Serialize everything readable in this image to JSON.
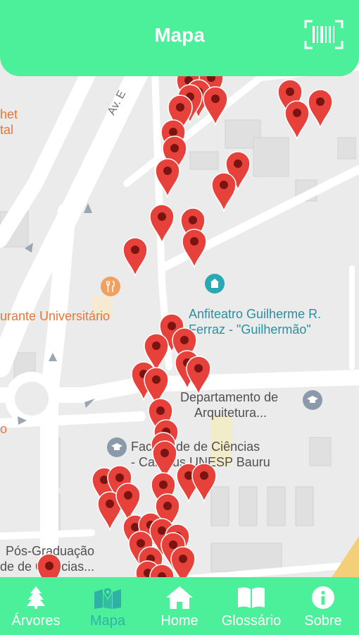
{
  "header": {
    "title": "Mapa",
    "scan_icon": "barcode-scan-icon"
  },
  "map": {
    "labels": {
      "road_av": "Av. E",
      "restaurant": "urante Universitário",
      "anfiteatro_line1": "Anfiteatro Guilherme R.",
      "anfiteatro_line2": "Ferraz - \"Guilhermão\"",
      "departamento_line1": "Departamento de",
      "departamento_line2": "Arquitetura...",
      "faculdade_line1": "Faculdade de Ciências",
      "faculdade_line2": "- Campus UNESP Bauru",
      "posgrad_line1": "Pós-Graduação",
      "posgrad_line2": "de de Ciências...",
      "edge_top1": "het",
      "edge_top2": "tal",
      "edge_mid": "o"
    },
    "colors": {
      "pin": "#e6413a",
      "pin_dot": "#7a1410",
      "poi_teal": "#2aa8b4",
      "poi_orange": "#f0a060",
      "poi_gray": "#8a9aa8"
    }
  },
  "tabs": [
    {
      "label": "Árvores",
      "icon": "tree-icon",
      "active": false
    },
    {
      "label": "Mapa",
      "icon": "map-icon",
      "active": true
    },
    {
      "label": "Home",
      "icon": "home-icon",
      "active": false
    },
    {
      "label": "Glossário",
      "icon": "book-icon",
      "active": false
    },
    {
      "label": "Sobre",
      "icon": "info-icon",
      "active": false
    }
  ]
}
